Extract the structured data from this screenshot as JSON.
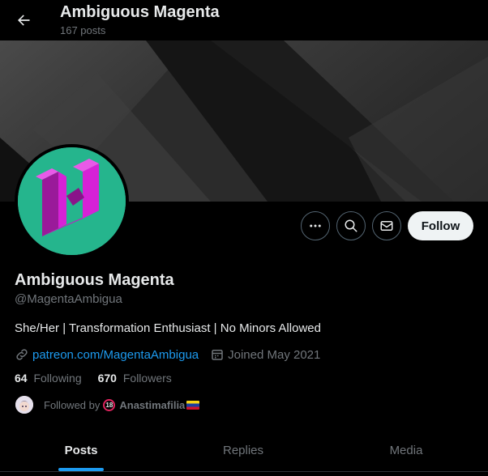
{
  "header": {
    "title": "Ambiguous Magenta",
    "post_count": "167 posts",
    "back_icon": "arrow-left-icon"
  },
  "profile": {
    "display_name": "Ambiguous Magenta",
    "handle": "@MagentaAmbigua",
    "bio": "She/Her | Transformation Enthusiast | No Minors Allowed",
    "website": "patreon.com/MagentaAmbigua",
    "joined": "Joined May 2021",
    "following_count": "64",
    "following_label": "Following",
    "followers_count": "670",
    "followers_label": "Followers",
    "followed_by_prefix": "Followed by",
    "followed_by_name": "Anastimafilia",
    "followed_by_badge": "18"
  },
  "actions": {
    "more_icon": "more-horizontal-icon",
    "search_icon": "search-icon",
    "message_icon": "envelope-icon",
    "follow_label": "Follow"
  },
  "tabs": [
    {
      "label": "Posts",
      "active": true
    },
    {
      "label": "Replies",
      "active": false
    },
    {
      "label": "Media",
      "active": false
    }
  ],
  "colors": {
    "background": "#000000",
    "accent": "#1d9bf0",
    "avatar_bg": "#25b58d",
    "avatar_logo": "#d622d6",
    "follow_button_bg": "#eff3f4"
  }
}
